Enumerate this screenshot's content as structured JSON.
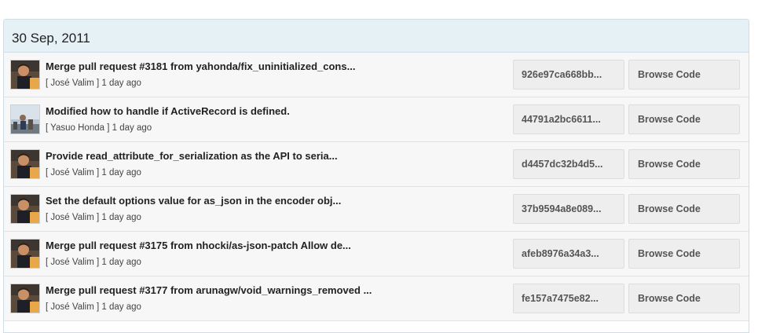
{
  "panel": {
    "date_header": "30 Sep, 2011"
  },
  "commits": [
    {
      "title": "Merge pull request #3181 from yahonda/fix_uninitialized_cons...",
      "author": "[ José Valim ]",
      "time": "1 day ago",
      "sha": "926e97ca668bb...",
      "browse_label": "Browse Code",
      "avatar": "jose-valim-avatar"
    },
    {
      "title": "Modified how to handle if ActiveRecord is defined.",
      "author": "[ Yasuo Honda ]",
      "time": "1 day ago",
      "sha": "44791a2bc6611...",
      "browse_label": "Browse Code",
      "avatar": "yasuo-honda-avatar"
    },
    {
      "title": "Provide read_attribute_for_serialization as the API to seria...",
      "author": "[ José Valim ]",
      "time": "1 day ago",
      "sha": "d4457dc32b4d5...",
      "browse_label": "Browse Code",
      "avatar": "jose-valim-avatar"
    },
    {
      "title": "Set the default options value for as_json in the encoder obj...",
      "author": "[ José Valim ]",
      "time": "1 day ago",
      "sha": "37b9594a8e089...",
      "browse_label": "Browse Code",
      "avatar": "jose-valim-avatar"
    },
    {
      "title": "Merge pull request #3175 from nhocki/as-json-patch Allow de...",
      "author": "[ José Valim ]",
      "time": "1 day ago",
      "sha": "afeb8976a34a3...",
      "browse_label": "Browse Code",
      "avatar": "jose-valim-avatar"
    },
    {
      "title": "Merge pull request #3177 from arunagw/void_warnings_removed ...",
      "author": "[ José Valim ]",
      "time": "1 day ago",
      "sha": "fe157a7475e82...",
      "browse_label": "Browse Code",
      "avatar": "jose-valim-avatar"
    }
  ]
}
